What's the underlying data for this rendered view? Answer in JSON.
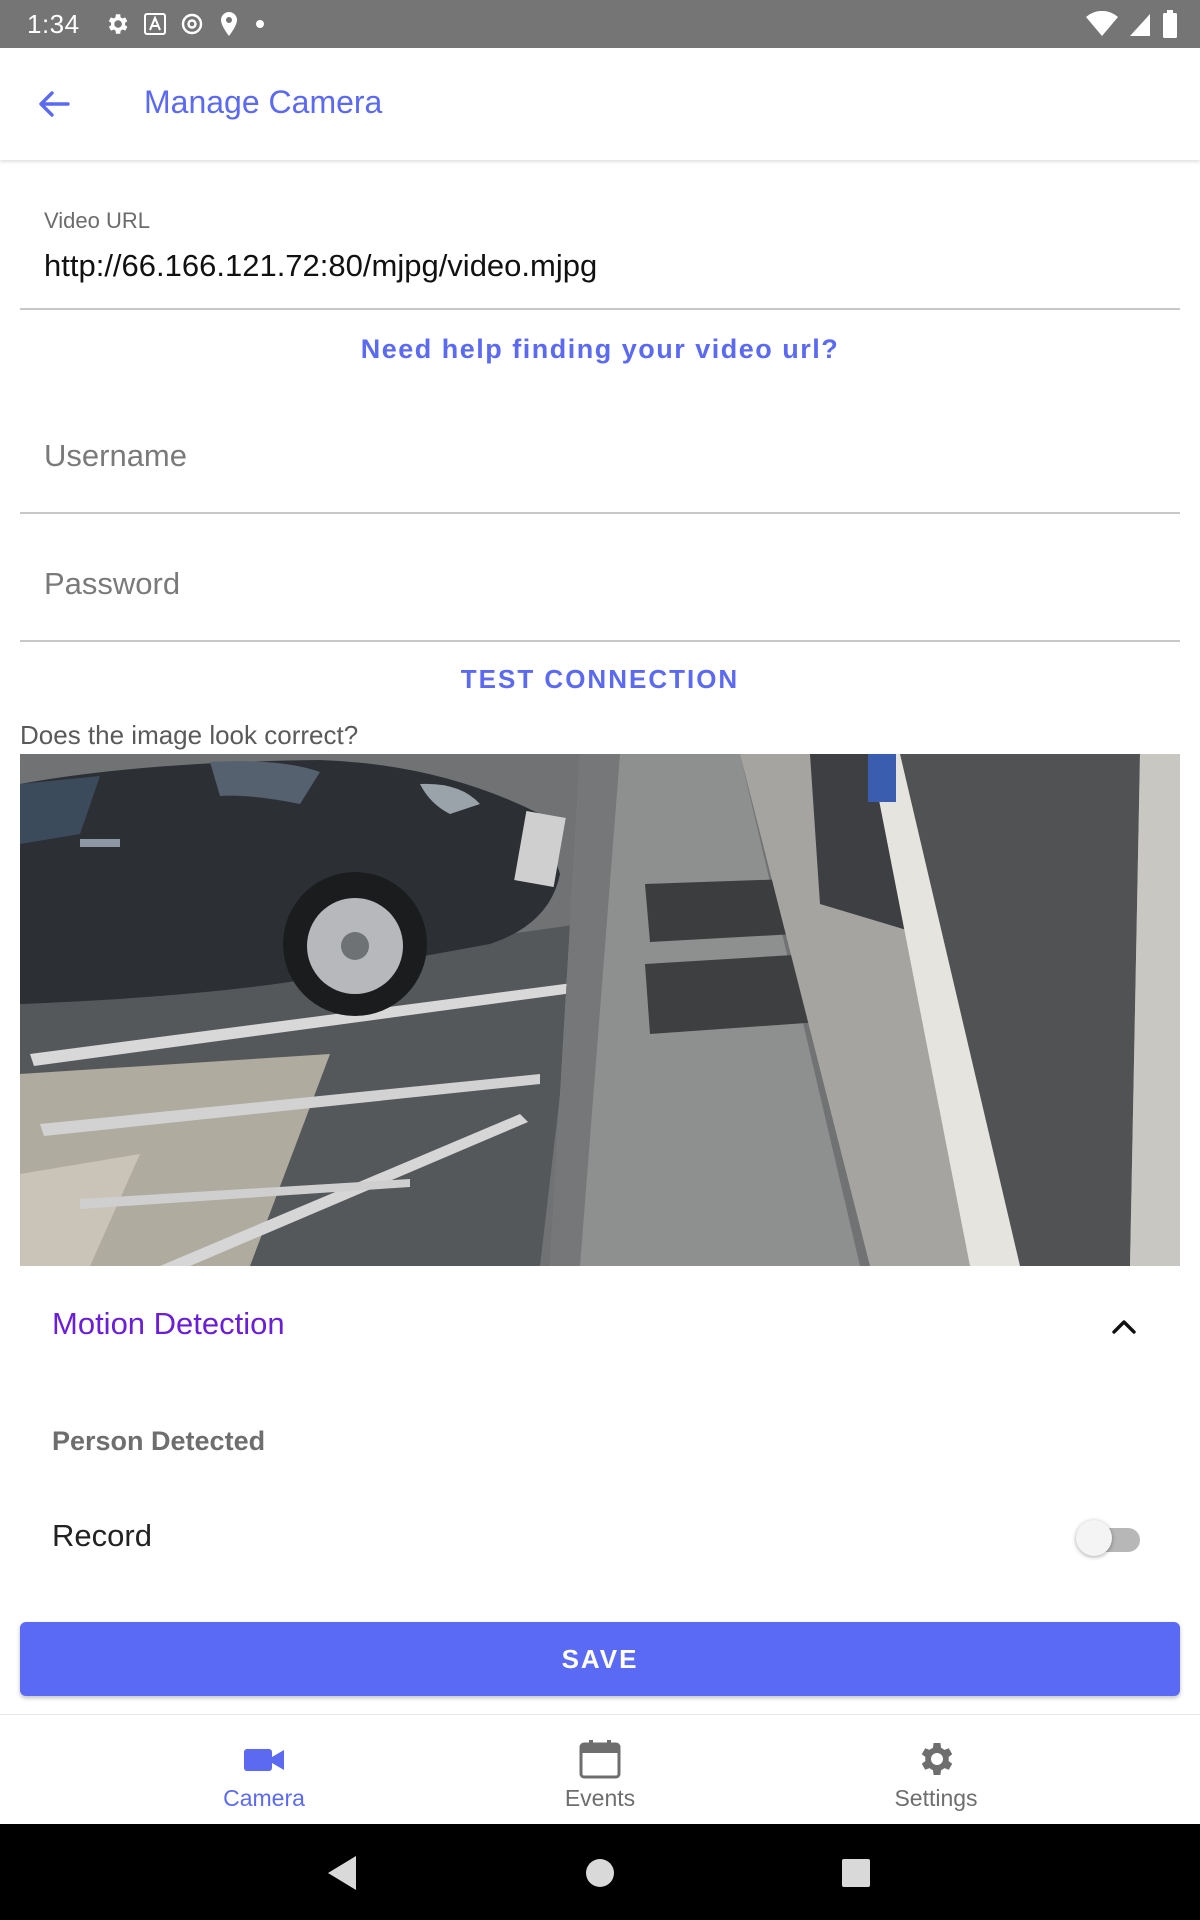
{
  "status_bar": {
    "time": "1:34",
    "icons": [
      "settings-icon",
      "font-a-icon",
      "at-sign-icon",
      "location-pin-icon",
      "dot-icon",
      "wifi-icon",
      "cell-signal-icon",
      "battery-icon"
    ]
  },
  "app_bar": {
    "title": "Manage Camera",
    "back_icon": "arrow-back-icon"
  },
  "form": {
    "video_url_label": "Video URL",
    "video_url_value": "http://66.166.121.72:80/mjpg/video.mjpg",
    "help_link": "Need help finding your video url?",
    "username_placeholder": "Username",
    "password_placeholder": "Password",
    "test_connection": "TEST CONNECTION"
  },
  "preview": {
    "question": "Does the image look correct?"
  },
  "motion_detection": {
    "title": "Motion Detection",
    "expanded": true,
    "subheading": "Person Detected",
    "record_label": "Record",
    "record_enabled": false
  },
  "save_label": "SAVE",
  "bottom_nav": [
    {
      "label": "Camera",
      "icon": "videocam-icon",
      "active": true
    },
    {
      "label": "Events",
      "icon": "calendar-icon",
      "active": false
    },
    {
      "label": "Settings",
      "icon": "gear-icon",
      "active": false
    }
  ],
  "system_nav": [
    "back-triangle-icon",
    "home-circle-icon",
    "recents-square-icon"
  ],
  "colors": {
    "accent": "#5b6af0",
    "section_title": "#6a1fd6",
    "save_button": "#5b6af5",
    "inactive_nav": "#6e6e6e"
  }
}
